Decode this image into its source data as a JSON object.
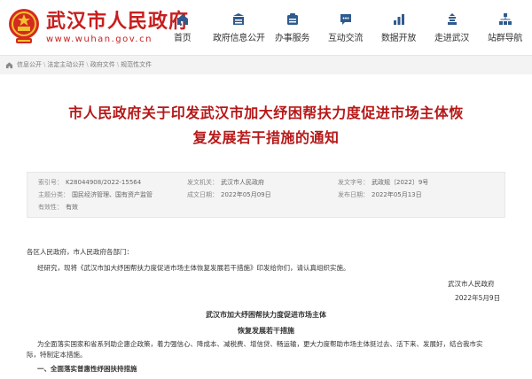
{
  "site": {
    "name": "武汉市人民政府",
    "url": "www.wuhan.gov.cn"
  },
  "nav": [
    {
      "label": "首页",
      "icon": "home-icon"
    },
    {
      "label": "政府信息公开",
      "icon": "info-open-icon"
    },
    {
      "label": "办事服务",
      "icon": "service-icon"
    },
    {
      "label": "互动交流",
      "icon": "chat-icon"
    },
    {
      "label": "数据开放",
      "icon": "data-icon"
    },
    {
      "label": "走进武汉",
      "icon": "landmark-icon"
    },
    {
      "label": "站群导航",
      "icon": "sitemap-icon"
    }
  ],
  "breadcrumb": [
    "信息公开",
    "法定主动公开",
    "政府文件",
    "规范性文件"
  ],
  "article": {
    "title_line1": "市人民政府关于印发武汉市加大纾困帮扶力度促进市场主体恢",
    "title_line2": "复发展若干措施的通知"
  },
  "meta": {
    "index_label": "索引号：",
    "index_value": "K28044908/2022-15564",
    "issuer_label": "发文机关：",
    "issuer_value": "武汉市人民政府",
    "docno_label": "发文字号：",
    "docno_value": "武政规〔2022〕9号",
    "topic_label": "主题分类：",
    "topic_value": "国民经济管理、国有资产监管",
    "created_label": "成文日期：",
    "created_value": "2022年05月09日",
    "published_label": "发布日期：",
    "published_value": "2022年05月13日",
    "validity_label": "有效性：",
    "validity_value": "有效"
  },
  "content": {
    "recipients": "各区人民政府，市人民政府各部门：",
    "para1": "经研究，现将《武汉市加大纾困帮扶力度促进市场主体恢复发展若干措施》印发给你们，请认真组织实施。",
    "signer": "武汉市人民政府",
    "sign_date": "2022年5月9日",
    "attach_title1": "武汉市加大纾困帮扶力度促进市场主体",
    "attach_title2": "恢复发展若干措施",
    "intro1": "为全面落实国家和省系列助企惠企政策，着力强信心、降成本、减税费、增信贷、畅运输，更大力度帮助市场主体挺过去、活下来、发展好，结合我市实",
    "intro2": "际，特制定本措施。",
    "section1": "一、全面落实普惠性纾困扶持措施"
  },
  "colors": {
    "brand_red": "#c81e1e",
    "title_red": "#b71818"
  }
}
